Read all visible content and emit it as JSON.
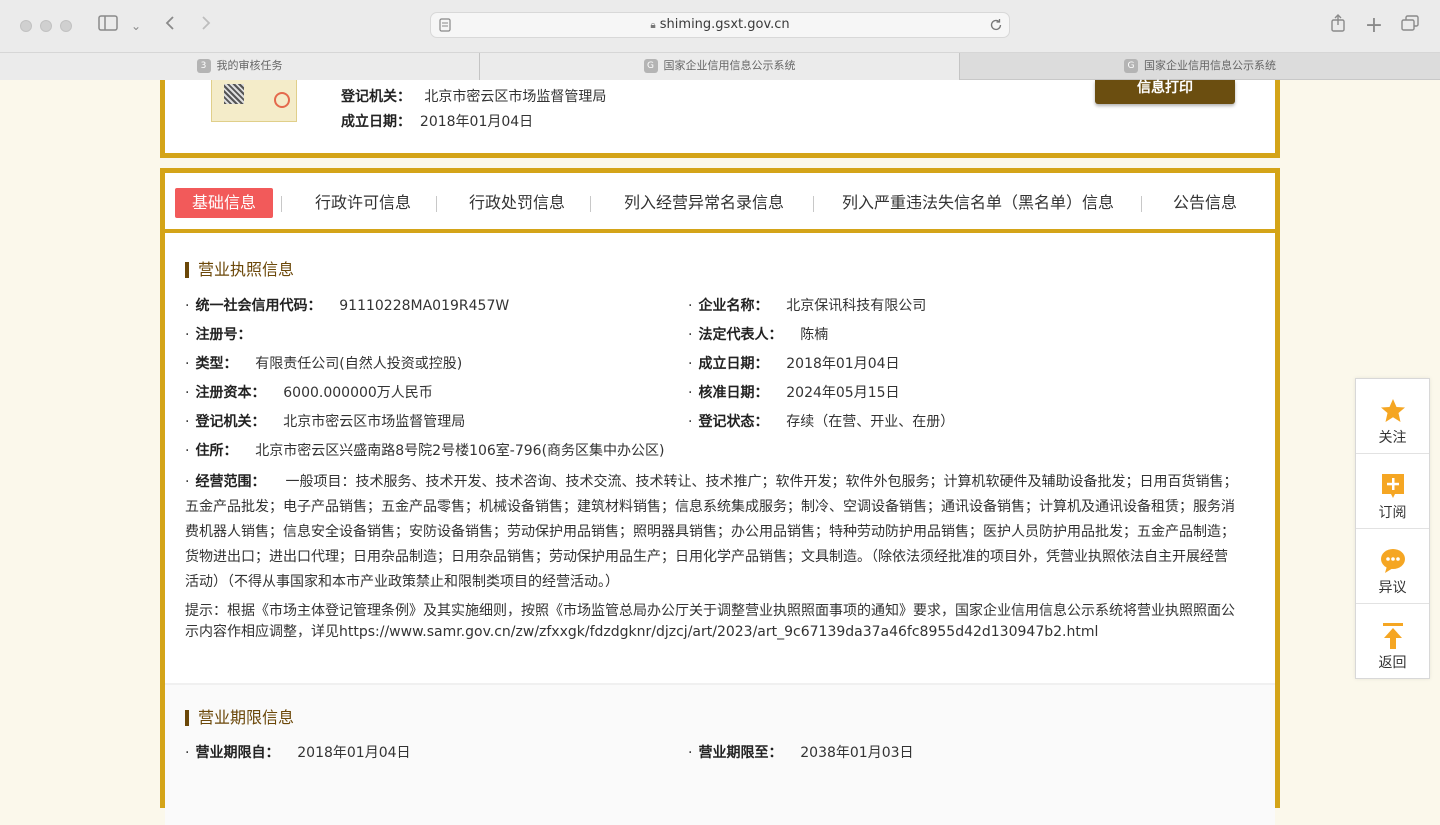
{
  "browser": {
    "url": "shiming.gsxt.gov.cn",
    "tabs": [
      {
        "label": "我的审核任务",
        "favicon": "3",
        "active": true
      },
      {
        "label": "国家企业信用信息公示系统",
        "favicon": "G",
        "active": false
      },
      {
        "label": "国家企业信用信息公示系统",
        "favicon": "G",
        "active": false
      }
    ]
  },
  "header_card": {
    "reg_authority_label": "登记机关：",
    "reg_authority_value": "北京市密云区市场监督管理局",
    "est_date_label": "成立日期：",
    "est_date_value": "2018年01月04日",
    "print_button": "信息打印"
  },
  "nav": {
    "tabs": [
      "基础信息",
      "行政许可信息",
      "行政处罚信息",
      "列入经营异常名录信息",
      "列入严重违法失信名单（黑名单）信息",
      "公告信息"
    ],
    "active_index": 0
  },
  "license": {
    "title": "营业执照信息",
    "fields": {
      "credit_code": {
        "label": "统一社会信用代码：",
        "value": "91110228MA019R457W"
      },
      "company_name": {
        "label": "企业名称：",
        "value": "北京保讯科技有限公司"
      },
      "reg_no": {
        "label": "注册号：",
        "value": ""
      },
      "legal_rep": {
        "label": "法定代表人：",
        "value": "陈楠"
      },
      "type": {
        "label": "类型：",
        "value": "有限责任公司(自然人投资或控股)"
      },
      "est_date": {
        "label": "成立日期：",
        "value": "2018年01月04日"
      },
      "capital": {
        "label": "注册资本：",
        "value": "6000.000000万人民币"
      },
      "approval_date": {
        "label": "核准日期：",
        "value": "2024年05月15日"
      },
      "authority": {
        "label": "登记机关：",
        "value": "北京市密云区市场监督管理局"
      },
      "status": {
        "label": "登记状态：",
        "value": "存续（在营、开业、在册）"
      },
      "address": {
        "label": "住所：",
        "value": "北京市密云区兴盛南路8号院2号楼106室-796(商务区集中办公区)"
      }
    },
    "scope_label": "经营范围：",
    "scope_value": "一般项目：技术服务、技术开发、技术咨询、技术交流、技术转让、技术推广；软件开发；软件外包服务；计算机软硬件及辅助设备批发；日用百货销售；五金产品批发；电子产品销售；五金产品零售；机械设备销售；建筑材料销售；信息系统集成服务；制冷、空调设备销售；通讯设备销售；计算机及通讯设备租赁；服务消费机器人销售；信息安全设备销售；安防设备销售；劳动保护用品销售；照明器具销售；办公用品销售；特种劳动防护用品销售；医护人员防护用品批发；五金产品制造；货物进出口；进出口代理；日用杂品制造；日用杂品销售；劳动保护用品生产；日用化学产品销售；文具制造。（除依法须经批准的项目外，凭营业执照依法自主开展经营活动）（不得从事国家和本市产业政策禁止和限制类项目的经营活动。）",
    "tip": "提示：根据《市场主体登记管理条例》及其实施细则，按照《市场监管总局办公厅关于调整营业执照照面事项的通知》要求，国家企业信用信息公示系统将营业执照照面公示内容作相应调整，详见https://www.samr.gov.cn/zw/zfxxgk/fdzdgknr/djzcj/art/2023/art_9c67139da37a46fc8955d42d130947b2.html"
  },
  "term": {
    "title": "营业期限信息",
    "from_label": "营业期限自：",
    "from_value": "2018年01月04日",
    "to_label": "营业期限至：",
    "to_value": "2038年01月03日"
  },
  "float_bar": {
    "items": [
      {
        "label": "关注",
        "icon": "star-icon"
      },
      {
        "label": "订阅",
        "icon": "plus-square-icon"
      },
      {
        "label": "异议",
        "icon": "speech-bubble-icon"
      },
      {
        "label": "返回",
        "icon": "arrow-up-icon"
      }
    ]
  },
  "colors": {
    "gold_border": "#d4a418",
    "active_tab": "#f25a5a",
    "brown_heading": "#6b4708",
    "float_icon": "#f5a623"
  }
}
